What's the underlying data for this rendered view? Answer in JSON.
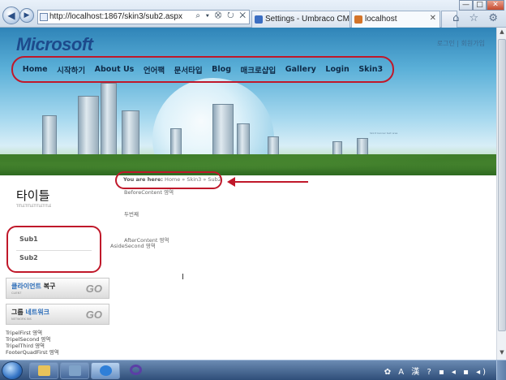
{
  "browser": {
    "address": "http://localhost:1867/skin3/sub2.aspx",
    "address_tools": "⌕ ▾ ⛒ ↻ ✕",
    "tabs": [
      {
        "label": "Settings - Umbraco CMS - lo..."
      },
      {
        "label": "localhost"
      }
    ],
    "window_buttons": {
      "minimize": "—",
      "maximize": "□",
      "close": "✕"
    },
    "toolbar_icons": "⌂ ☆ ⚙"
  },
  "site": {
    "logo": "Microsoft",
    "top_links": "로그인  |  회원가입",
    "nav": [
      "Home",
      "시작하기",
      "About Us",
      "언어팩",
      "문서타입",
      "Blog",
      "매크로샵입",
      "Gallery",
      "Login",
      "Skin3"
    ],
    "banner_note": "Skin3 banner text area"
  },
  "sidebar": {
    "title": "타이틀",
    "title_sub": "TITLETITLETITLETITLE",
    "submenu": [
      "Sub1",
      "Sub2"
    ],
    "promos": [
      {
        "title_a": "클라이언트",
        "title_b": " 복구",
        "sub": "CLIENT",
        "go": "GO"
      },
      {
        "title_a": "그룹 ",
        "title_b": "네트워크",
        "sub": "NETWORK INS",
        "go": "GO"
      }
    ],
    "regions": [
      "TripelFirst 영역",
      "TripelSecond 영역",
      "TripelThird 영역",
      "FooterQuadFirst 영역"
    ]
  },
  "main": {
    "breadcrumb_label": "You are here:",
    "breadcrumb_path": " Home » Skin3 » Sub2",
    "before_content": "BeforeContent 영역",
    "body_text": "두번째",
    "after_content": "AfterContent 영역",
    "aside_second": "AsideSecond 영역"
  },
  "colors": {
    "annotation": "#c0182a",
    "nav_text": "#0f2a47",
    "logo": "#1d4a8c"
  }
}
